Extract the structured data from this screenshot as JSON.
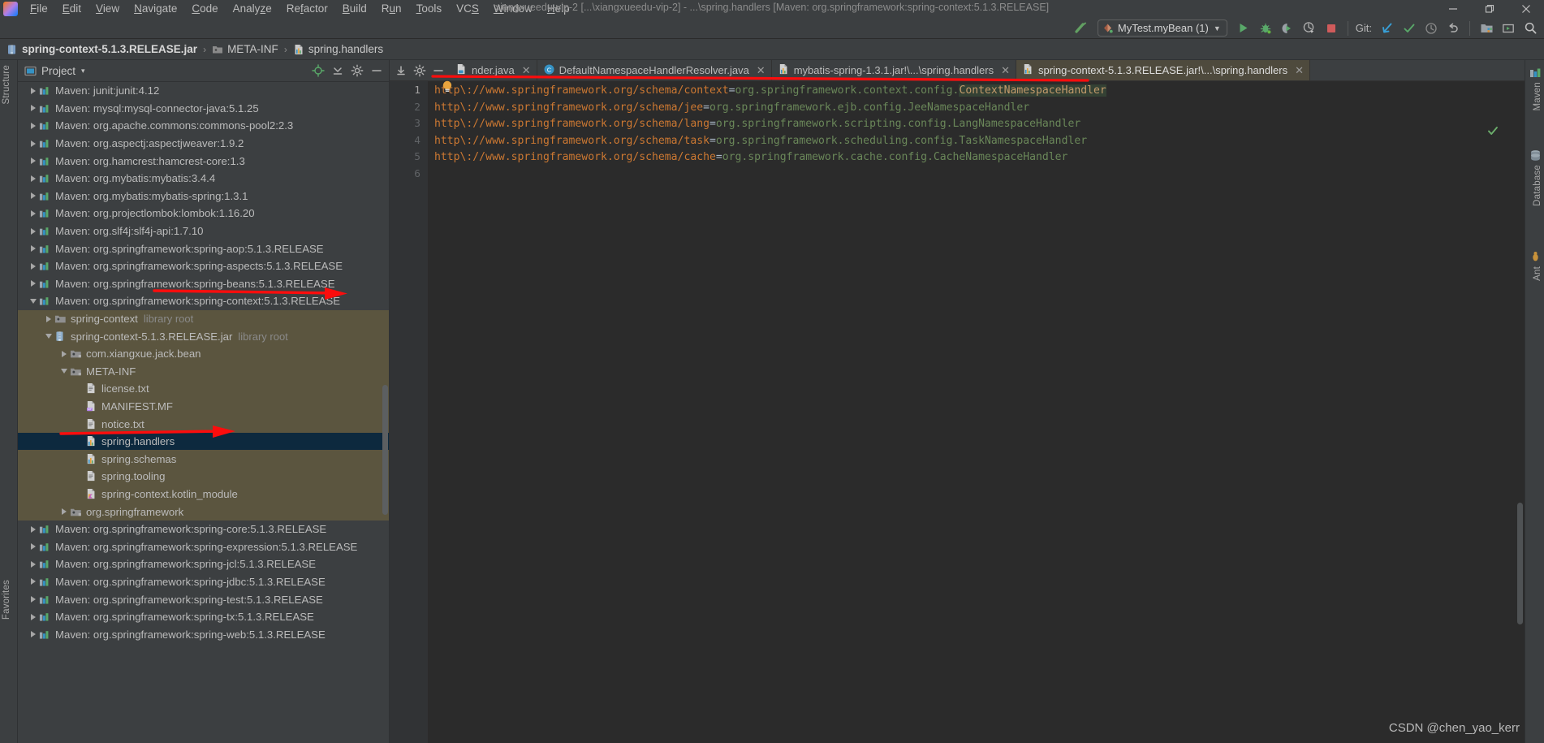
{
  "window": {
    "title": "xiangxueedu-vip-2 [...\\xiangxueedu-vip-2] - ...\\spring.handlers [Maven: org.springframework:spring-context:5.1.3.RELEASE]",
    "minimize": "—",
    "maximize": "❐",
    "close": "✕"
  },
  "menubar": {
    "items": [
      {
        "label": "File",
        "mnemonic": "F"
      },
      {
        "label": "Edit",
        "mnemonic": "E"
      },
      {
        "label": "View",
        "mnemonic": "V"
      },
      {
        "label": "Navigate",
        "mnemonic": "N"
      },
      {
        "label": "Code",
        "mnemonic": "C"
      },
      {
        "label": "Analyze",
        "mnemonic": "z"
      },
      {
        "label": "Refactor",
        "mnemonic": "f"
      },
      {
        "label": "Build",
        "mnemonic": "B"
      },
      {
        "label": "Run",
        "mnemonic": "u"
      },
      {
        "label": "Tools",
        "mnemonic": "T"
      },
      {
        "label": "VCS",
        "mnemonic": "S"
      },
      {
        "label": "Window",
        "mnemonic": "W"
      },
      {
        "label": "Help",
        "mnemonic": "H"
      }
    ]
  },
  "toolbar": {
    "run_config": "MyTest.myBean (1)",
    "git_label": "Git:",
    "icons": [
      "build-icon",
      "run-icon",
      "debug-icon",
      "run-coverage-icon",
      "profile-icon",
      "stop-icon",
      "git-update-icon",
      "git-commit-icon",
      "git-history-icon",
      "git-revert-icon",
      "project-structure-icon",
      "select-target-icon",
      "search-everywhere-icon"
    ]
  },
  "breadcrumb": {
    "items": [
      {
        "label": "spring-context-5.1.3.RELEASE.jar",
        "icon": "jar-icon",
        "bold": true
      },
      {
        "label": "META-INF",
        "icon": "folder-icon",
        "bold": false
      },
      {
        "label": "spring.handlers",
        "icon": "properties-icon",
        "bold": false
      }
    ],
    "separator": "›"
  },
  "left_strip": {
    "labels": [
      "Structure",
      "Favorites"
    ]
  },
  "right_strip": {
    "labels": [
      "Maven",
      "Database",
      "Ant"
    ]
  },
  "project_panel": {
    "title": "Project",
    "dropdown_caret": "▾",
    "header_icons": [
      "locate-icon",
      "collapse-all-icon",
      "settings-icon",
      "hide-icon"
    ],
    "tree": [
      {
        "depth": 0,
        "twig": "right",
        "icon": "maven-icon",
        "label": "Maven: junit:junit:4.12",
        "sub": "",
        "sel": ""
      },
      {
        "depth": 0,
        "twig": "right",
        "icon": "maven-icon",
        "label": "Maven: mysql:mysql-connector-java:5.1.25",
        "sub": "",
        "sel": ""
      },
      {
        "depth": 0,
        "twig": "right",
        "icon": "maven-icon",
        "label": "Maven: org.apache.commons:commons-pool2:2.3",
        "sub": "",
        "sel": ""
      },
      {
        "depth": 0,
        "twig": "right",
        "icon": "maven-icon",
        "label": "Maven: org.aspectj:aspectjweaver:1.9.2",
        "sub": "",
        "sel": ""
      },
      {
        "depth": 0,
        "twig": "right",
        "icon": "maven-icon",
        "label": "Maven: org.hamcrest:hamcrest-core:1.3",
        "sub": "",
        "sel": ""
      },
      {
        "depth": 0,
        "twig": "right",
        "icon": "maven-icon",
        "label": "Maven: org.mybatis:mybatis:3.4.4",
        "sub": "",
        "sel": ""
      },
      {
        "depth": 0,
        "twig": "right",
        "icon": "maven-icon",
        "label": "Maven: org.mybatis:mybatis-spring:1.3.1",
        "sub": "",
        "sel": ""
      },
      {
        "depth": 0,
        "twig": "right",
        "icon": "maven-icon",
        "label": "Maven: org.projectlombok:lombok:1.16.20",
        "sub": "",
        "sel": ""
      },
      {
        "depth": 0,
        "twig": "right",
        "icon": "maven-icon",
        "label": "Maven: org.slf4j:slf4j-api:1.7.10",
        "sub": "",
        "sel": ""
      },
      {
        "depth": 0,
        "twig": "right",
        "icon": "maven-icon",
        "label": "Maven: org.springframework:spring-aop:5.1.3.RELEASE",
        "sub": "",
        "sel": ""
      },
      {
        "depth": 0,
        "twig": "right",
        "icon": "maven-icon",
        "label": "Maven: org.springframework:spring-aspects:5.1.3.RELEASE",
        "sub": "",
        "sel": ""
      },
      {
        "depth": 0,
        "twig": "right",
        "icon": "maven-icon",
        "label": "Maven: org.springframework:spring-beans:5.1.3.RELEASE",
        "sub": "",
        "sel": ""
      },
      {
        "depth": 0,
        "twig": "down",
        "icon": "maven-icon",
        "label": "Maven: org.springframework:spring-context:5.1.3.RELEASE",
        "sub": "",
        "sel": ""
      },
      {
        "depth": 1,
        "twig": "right",
        "icon": "libroot-icon",
        "label": "spring-context",
        "sub": "library root",
        "sel": "jar"
      },
      {
        "depth": 1,
        "twig": "down",
        "icon": "jar-icon",
        "label": "spring-context-5.1.3.RELEASE.jar",
        "sub": "library root",
        "sel": "jar"
      },
      {
        "depth": 2,
        "twig": "right",
        "icon": "package-icon",
        "label": "com.xiangxue.jack.bean",
        "sub": "",
        "sel": "jar"
      },
      {
        "depth": 2,
        "twig": "down",
        "icon": "package-icon",
        "label": "META-INF",
        "sub": "",
        "sel": "jar"
      },
      {
        "depth": 3,
        "twig": "none",
        "icon": "text-icon",
        "label": "license.txt",
        "sub": "",
        "sel": "jar"
      },
      {
        "depth": 3,
        "twig": "none",
        "icon": "manifest-icon",
        "label": "MANIFEST.MF",
        "sub": "",
        "sel": "jar"
      },
      {
        "depth": 3,
        "twig": "none",
        "icon": "text-icon",
        "label": "notice.txt",
        "sub": "",
        "sel": "jar"
      },
      {
        "depth": 3,
        "twig": "none",
        "icon": "properties-icon",
        "label": "spring.handlers",
        "sub": "",
        "sel": "blue"
      },
      {
        "depth": 3,
        "twig": "none",
        "icon": "properties-icon",
        "label": "spring.schemas",
        "sub": "",
        "sel": "jar"
      },
      {
        "depth": 3,
        "twig": "none",
        "icon": "text-icon",
        "label": "spring.tooling",
        "sub": "",
        "sel": "jar"
      },
      {
        "depth": 3,
        "twig": "none",
        "icon": "kotlin-icon",
        "label": "spring-context.kotlin_module",
        "sub": "",
        "sel": "jar"
      },
      {
        "depth": 2,
        "twig": "right",
        "icon": "package-icon",
        "label": "org.springframework",
        "sub": "",
        "sel": "jar"
      },
      {
        "depth": 0,
        "twig": "right",
        "icon": "maven-icon",
        "label": "Maven: org.springframework:spring-core:5.1.3.RELEASE",
        "sub": "",
        "sel": ""
      },
      {
        "depth": 0,
        "twig": "right",
        "icon": "maven-icon",
        "label": "Maven: org.springframework:spring-expression:5.1.3.RELEASE",
        "sub": "",
        "sel": ""
      },
      {
        "depth": 0,
        "twig": "right",
        "icon": "maven-icon",
        "label": "Maven: org.springframework:spring-jcl:5.1.3.RELEASE",
        "sub": "",
        "sel": ""
      },
      {
        "depth": 0,
        "twig": "right",
        "icon": "maven-icon",
        "label": "Maven: org.springframework:spring-jdbc:5.1.3.RELEASE",
        "sub": "",
        "sel": ""
      },
      {
        "depth": 0,
        "twig": "right",
        "icon": "maven-icon",
        "label": "Maven: org.springframework:spring-test:5.1.3.RELEASE",
        "sub": "",
        "sel": ""
      },
      {
        "depth": 0,
        "twig": "right",
        "icon": "maven-icon",
        "label": "Maven: org.springframework:spring-tx:5.1.3.RELEASE",
        "sub": "",
        "sel": ""
      },
      {
        "depth": 0,
        "twig": "right",
        "icon": "maven-icon",
        "label": "Maven: org.springframework:spring-web:5.1.3.RELEASE",
        "sub": "",
        "sel": ""
      }
    ]
  },
  "editor": {
    "tabs": [
      {
        "label": "nder.java",
        "icon": "java-icon",
        "active": false,
        "truncated": true
      },
      {
        "label": "DefaultNamespaceHandlerResolver.java",
        "icon": "class-icon",
        "active": false,
        "truncated": false
      },
      {
        "label": "mybatis-spring-1.3.1.jar!\\...\\spring.handlers",
        "icon": "properties-icon",
        "active": false,
        "truncated": false
      },
      {
        "label": "spring-context-5.1.3.RELEASE.jar!\\...\\spring.handlers",
        "icon": "properties-icon",
        "active": true,
        "truncated": false
      }
    ],
    "tab_close": "✕",
    "line_numbers": [
      "1",
      "2",
      "3",
      "4",
      "5",
      "6"
    ],
    "current_line": 1,
    "lines": [
      {
        "key": "http\\://www.springframework.org/schema/context",
        "eq": "=",
        "value": "org.springframework.context.config.",
        "highlight": "ContextNamespaceHandler"
      },
      {
        "key": "http\\://www.springframework.org/schema/jee",
        "eq": "=",
        "value": "org.springframework.ejb.config.JeeNamespaceHandler",
        "highlight": ""
      },
      {
        "key": "http\\://www.springframework.org/schema/lang",
        "eq": "=",
        "value": "org.springframework.scripting.config.LangNamespaceHandler",
        "highlight": ""
      },
      {
        "key": "http\\://www.springframework.org/schema/task",
        "eq": "=",
        "value": "org.springframework.scheduling.config.TaskNamespaceHandler",
        "highlight": ""
      },
      {
        "key": "http\\://www.springframework.org/schema/cache",
        "eq": "=",
        "value": "org.springframework.cache.config.CacheNamespaceHandler",
        "highlight": ""
      },
      {
        "key": "",
        "eq": "",
        "value": "",
        "highlight": ""
      }
    ],
    "inspection_status": "ok"
  },
  "annotations": {
    "color": "#fb0d0d",
    "items": [
      {
        "name": "underline-context-handler",
        "type": "line"
      },
      {
        "name": "arrow-to-spring-context-lib",
        "type": "arrow"
      },
      {
        "name": "arrow-to-spring-handlers",
        "type": "arrow"
      }
    ]
  },
  "watermark": {
    "text": "CSDN @chen_yao_kerr"
  },
  "colors": {
    "bg_chrome": "#3c3f41",
    "bg_editor": "#2b2b2b",
    "gutter": "#313335",
    "text": "#bbbbbb",
    "muted": "#8a8a8a",
    "selection_jar": "#5b553f",
    "selection_blue": "#0d293e",
    "key_orange": "#cc7832",
    "value_green": "#6a8759",
    "annotation_red": "#fb0d0d",
    "run_green": "#499c54"
  }
}
